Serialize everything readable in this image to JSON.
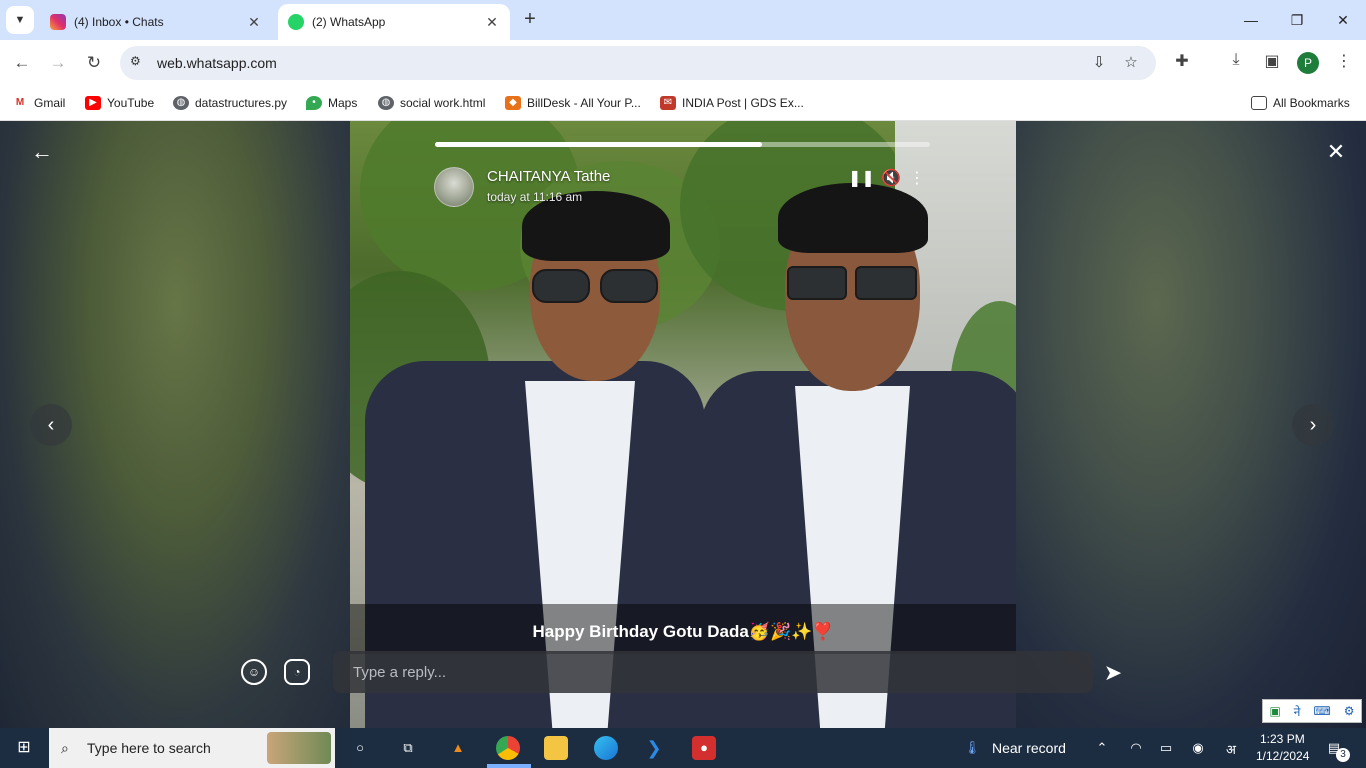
{
  "browser": {
    "tabs": [
      {
        "title": "(4) Inbox • Chats",
        "favicon": "instagram-icon"
      },
      {
        "title": "(2) WhatsApp",
        "favicon": "whatsapp-icon"
      }
    ],
    "url": "web.whatsapp.com",
    "profile_initial": "P",
    "bookmarks": [
      {
        "label": "Gmail",
        "icon": "gmail-icon"
      },
      {
        "label": "YouTube",
        "icon": "youtube-icon"
      },
      {
        "label": "datastructures.py",
        "icon": "globe-icon"
      },
      {
        "label": "Maps",
        "icon": "maps-icon"
      },
      {
        "label": "social work.html",
        "icon": "globe-icon"
      },
      {
        "label": "BillDesk - All Your P...",
        "icon": "billdesk-icon"
      },
      {
        "label": "INDIA Post | GDS Ex...",
        "icon": "indiapost-icon"
      }
    ],
    "all_bookmarks": "All Bookmarks"
  },
  "status_viewer": {
    "contact_name": "CHAITANYA Tathe",
    "timestamp": "today at 11:16 am",
    "progress": 0.66,
    "caption": "Happy Birthday Gotu Dada🥳🎉✨❣️",
    "reply_placeholder": "Type a reply..."
  },
  "taskbar": {
    "search_placeholder": "Type here to search",
    "weather_text": "Near record",
    "time": "1:23 PM",
    "date": "1/12/2024",
    "notification_count": "3",
    "lang": "अ"
  },
  "colors": {
    "tabstrip": "#d3e3fd",
    "taskbar": "#1c2d42",
    "avatar": "#1e7d3a"
  }
}
